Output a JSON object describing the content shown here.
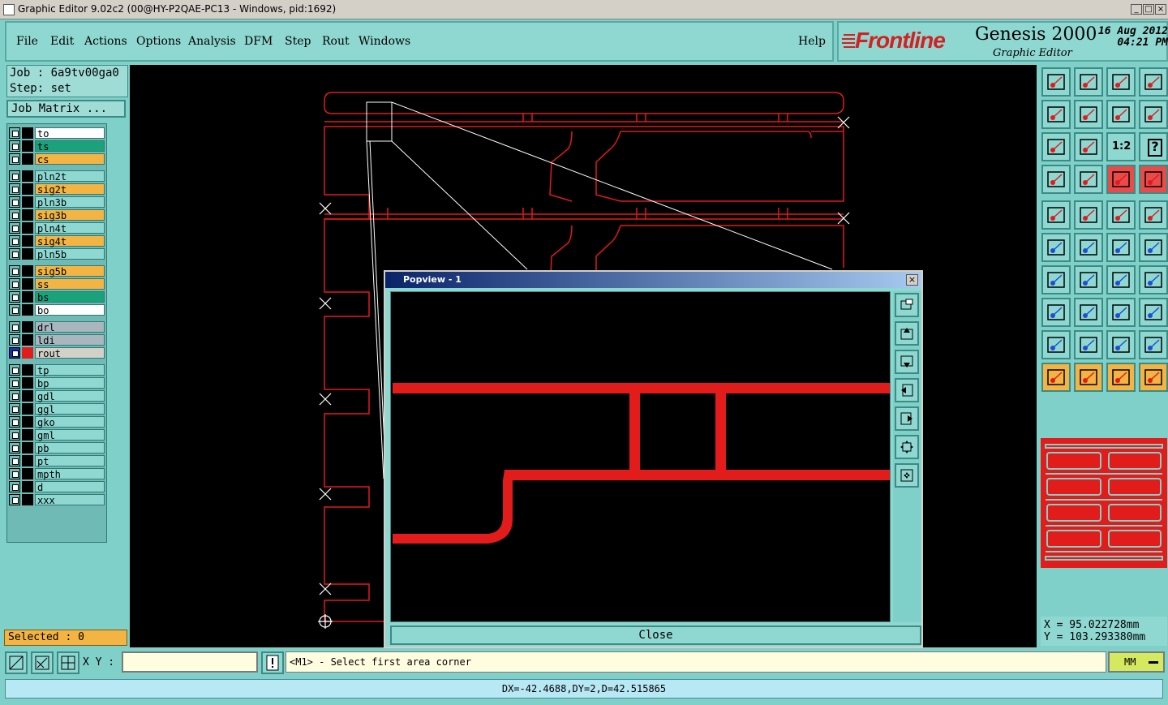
{
  "window": {
    "title": "Graphic Editor 9.02c2 (00@HY-P2QAE-PC13 - Windows, pid:1692)",
    "min": "_",
    "max": "□",
    "close": "×"
  },
  "menu": {
    "items": [
      "File",
      "Edit",
      "Actions",
      "Options",
      "Analysis",
      "DFM",
      "Step",
      "Rout",
      "Windows"
    ],
    "help": "Help"
  },
  "brand": {
    "logo": "Frontline",
    "product": "Genesis 2000",
    "subtitle": "Graphic Editor",
    "date": "16 Aug 2012",
    "time": "04:21 PM"
  },
  "job": {
    "job_line": "Job : 6a9tv00ga0",
    "step_line": "Step: set",
    "job_matrix": "Job Matrix ..."
  },
  "layers": [
    {
      "name": "to",
      "color": "#ffffff",
      "group": 0
    },
    {
      "name": "ts",
      "color": "#1aa37a",
      "group": 0
    },
    {
      "name": "cs",
      "color": "#f3b443",
      "group": 0
    },
    {
      "name": "pln2t",
      "color": "#8fd8d2",
      "group": 1
    },
    {
      "name": "sig2t",
      "color": "#f3b443",
      "group": 1
    },
    {
      "name": "pln3b",
      "color": "#8fd8d2",
      "group": 1
    },
    {
      "name": "sig3b",
      "color": "#f3b443",
      "group": 1
    },
    {
      "name": "pln4t",
      "color": "#8fd8d2",
      "group": 1
    },
    {
      "name": "sig4t",
      "color": "#f3b443",
      "group": 1
    },
    {
      "name": "pln5b",
      "color": "#8fd8d2",
      "group": 1
    },
    {
      "name": "sig5b",
      "color": "#f3b443",
      "group": 2
    },
    {
      "name": "ss",
      "color": "#f3b443",
      "group": 2
    },
    {
      "name": "bs",
      "color": "#1aa37a",
      "group": 2
    },
    {
      "name": "bo",
      "color": "#ffffff",
      "group": 2
    },
    {
      "name": "drl",
      "color": "#a9b6be",
      "group": 3
    },
    {
      "name": "ldi",
      "color": "#a9b6be",
      "group": 3
    },
    {
      "name": "rout",
      "color": "#d4d0c8",
      "group": 3,
      "active": true
    },
    {
      "name": "tp",
      "color": "#8fd8d2",
      "group": 4
    },
    {
      "name": "bp",
      "color": "#8fd8d2",
      "group": 4
    },
    {
      "name": "gdl",
      "color": "#8fd8d2",
      "group": 4
    },
    {
      "name": "ggl",
      "color": "#8fd8d2",
      "group": 4
    },
    {
      "name": "gko",
      "color": "#8fd8d2",
      "group": 4
    },
    {
      "name": "gml",
      "color": "#8fd8d2",
      "group": 4
    },
    {
      "name": "pb",
      "color": "#8fd8d2",
      "group": 4
    },
    {
      "name": "pt",
      "color": "#8fd8d2",
      "group": 4
    },
    {
      "name": "mpth",
      "color": "#8fd8d2",
      "group": 4
    },
    {
      "name": "d",
      "color": "#8fd8d2",
      "group": 4
    },
    {
      "name": "xxx",
      "color": "#8fd8d2",
      "group": 4
    }
  ],
  "selected": "Selected : 0",
  "toolbar": {
    "scale_label": "1:2",
    "help_label": "?"
  },
  "coords": {
    "x": "X = 95.022728mm",
    "y": "Y = 103.293380mm"
  },
  "popview": {
    "title": "Popview - 1",
    "close_label": "Close",
    "close_x": "×"
  },
  "bottom": {
    "xy_label": "X Y :",
    "xy_value": "",
    "prompt": "<M1> - Select first area corner",
    "unit": "MM",
    "status": "DX=-42.4688,DY=2,D=42.515865"
  },
  "colors": {
    "panel": "#7fd0c9",
    "accent": "#e21b1b",
    "highlight": "#f3b443"
  }
}
